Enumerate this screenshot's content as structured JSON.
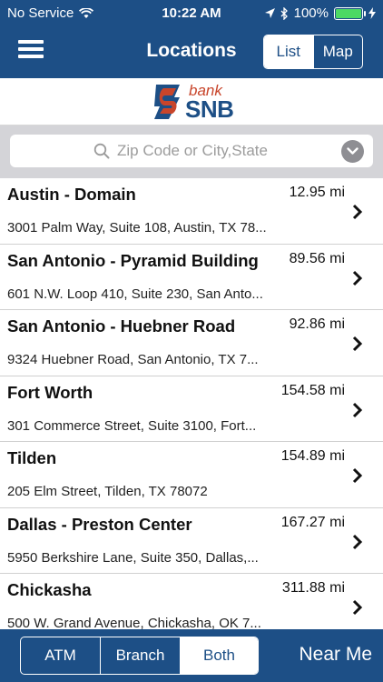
{
  "status_bar": {
    "carrier": "No Service",
    "time": "10:22 AM",
    "battery": "100%",
    "battery_level": 1.0
  },
  "nav": {
    "title": "Locations",
    "view_options": [
      "List",
      "Map"
    ],
    "selected_view": "List"
  },
  "logo": {
    "bank_text": "bank",
    "snb_text": "SNB"
  },
  "search": {
    "placeholder": "Zip Code or City,State",
    "value": ""
  },
  "locations": [
    {
      "name": "Austin - Domain",
      "distance": "12.95 mi",
      "address": "3001 Palm Way, Suite 108, Austin, TX 78..."
    },
    {
      "name": "San Antonio - Pyramid Building",
      "distance": "89.56 mi",
      "address": "601 N.W. Loop 410, Suite 230, San Anto..."
    },
    {
      "name": "San Antonio - Huebner Road",
      "distance": "92.86 mi",
      "address": "9324 Huebner Road, San Antonio, TX 7..."
    },
    {
      "name": "Fort Worth",
      "distance": "154.58 mi",
      "address": "301 Commerce Street, Suite 3100, Fort..."
    },
    {
      "name": "Tilden",
      "distance": "154.89 mi",
      "address": "205 Elm Street, Tilden, TX 78072"
    },
    {
      "name": "Dallas - Preston Center",
      "distance": "167.27 mi",
      "address": "5950 Berkshire Lane, Suite 350, Dallas,..."
    },
    {
      "name": "Chickasha",
      "distance": "311.88 mi",
      "address": "500 W. Grand Avenue, Chickasha, OK 7..."
    }
  ],
  "filter": {
    "options": [
      "ATM",
      "Branch",
      "Both"
    ],
    "selected": "Both"
  },
  "near_me_label": "Near Me",
  "colors": {
    "primary": "#1d4f86",
    "accent_red": "#c8452b",
    "battery_green": "#4cd964"
  }
}
